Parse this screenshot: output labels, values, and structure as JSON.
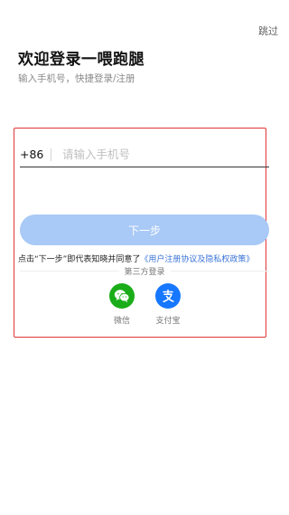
{
  "header": {
    "skip_label": "跳过",
    "title": "欢迎登录一喂跑腿",
    "subtitle": "输入手机号，快捷登录/注册"
  },
  "form": {
    "country_code": "+86",
    "phone_placeholder": "请输入手机号",
    "next_label": "下一步"
  },
  "agreement": {
    "prefix": "点击“下一步”即代表知晓并同意了",
    "link": "《用户注册协议及隐私权政策》"
  },
  "third_party": {
    "label": "第三方登录",
    "options": [
      {
        "label": "微信",
        "icon": "wechat-icon",
        "color": "#1aad19"
      },
      {
        "label": "支付宝",
        "icon": "alipay-icon",
        "color": "#1677ff"
      }
    ]
  },
  "colors": {
    "accent": "#3b74d8",
    "button_disabled": "#a9c9f6",
    "highlight_border": "#e0363a"
  }
}
